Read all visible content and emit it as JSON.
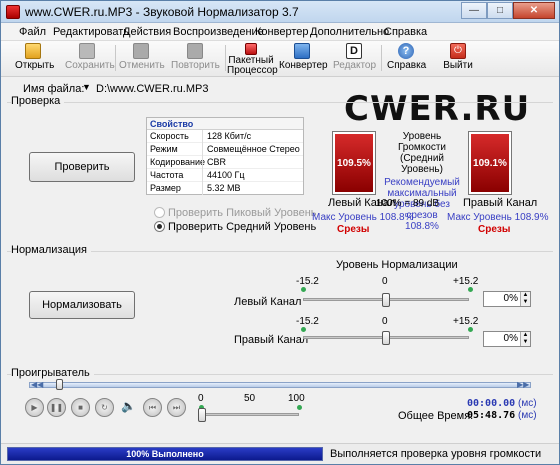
{
  "window": {
    "title": "www.CWER.ru.MP3 - Звуковой Нормализатор 3.7"
  },
  "menu": [
    "Файл",
    "Редактировать",
    "Действия",
    "Воспроизведение",
    "Конвертер",
    "Дополнительно",
    "Справка"
  ],
  "toolbar": {
    "open": "Открыть",
    "save": "Сохранить",
    "cancel": "Отменить",
    "repeat": "Повторить",
    "batch_l1": "Пакетный",
    "batch_l2": "Процессор",
    "convert": "Конвертер",
    "editor": "Редактор",
    "help": "Справка",
    "exit": "Выйти"
  },
  "file": {
    "label": "Имя файла:",
    "path": "D:\\www.CWER.ru.MP3"
  },
  "logo": {
    "text": "CWER.RU"
  },
  "check": {
    "title": "Проверка",
    "button": "Проверить",
    "props_header": "Свойство",
    "props": [
      {
        "k": "Скорость",
        "v": "128 Кбит/с"
      },
      {
        "k": "Режим",
        "v": "Совмещённое Стерео"
      },
      {
        "k": "Кодирование",
        "v": "CBR"
      },
      {
        "k": "Частота",
        "v": "44100 Гц"
      },
      {
        "k": "Размер",
        "v": "5.32 MB"
      }
    ],
    "radio_peak": "Проверить Пиковый Уровень",
    "radio_avg": "Проверить Средний Уровень",
    "left": {
      "value": "109.5%",
      "fill": 1.0,
      "label": "Левый Канал",
      "max": "Макс Уровень 108.8%",
      "clip": "Срезы"
    },
    "right": {
      "value": "109.1%",
      "fill": 1.0,
      "label": "Правый Канал",
      "max": "Макс Уровень 108.9%",
      "clip": "Срезы"
    },
    "loudness_l1": "Уровень Громкости",
    "loudness_l2": "(Средний Уровень)",
    "rec_l1": "Рекомендуемый",
    "rec_l2": "максимальный",
    "rec_l3": "уровень без срезов",
    "rec_l4": "108.8%",
    "db": "100% = 89 dB"
  },
  "normalize": {
    "title": "Нормализация",
    "button": "Нормализовать",
    "level_title": "Уровень Нормализации",
    "min": "-15.2",
    "zero": "0",
    "max": "+15.2",
    "left_label": "Левый Канал",
    "left_value": "0%",
    "right_label": "Правый Канал",
    "right_value": "0%"
  },
  "player": {
    "title": "Проигрыватель",
    "vol_0": "0",
    "vol_50": "50",
    "vol_100": "100",
    "time": "00:00.00",
    "time_unit": "(мс)",
    "total_label": "Общее Время:",
    "total": "05:48.76",
    "total_unit": "(мс)"
  },
  "status": {
    "progress": "100% Выполнено",
    "message": "Выполняется проверка уровня громкости"
  }
}
